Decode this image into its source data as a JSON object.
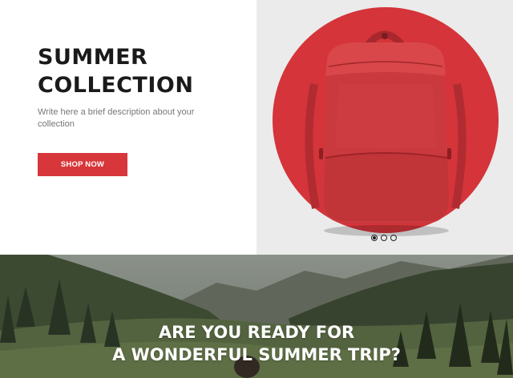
{
  "hero": {
    "title_line1": "SUMMER",
    "title_line2": "COLLECTION",
    "description": "Write here a brief description about your collection",
    "cta_label": "SHOP NOW",
    "accent_color": "#d7373a",
    "image": "red-backpack",
    "slider": {
      "total_slides": 3,
      "active_index": 1
    }
  },
  "banner": {
    "image": "mountain-valley-landscape",
    "headline_line1": "ARE YOU READY FOR",
    "headline_line2": "A WONDERFUL SUMMER TRIP?"
  }
}
